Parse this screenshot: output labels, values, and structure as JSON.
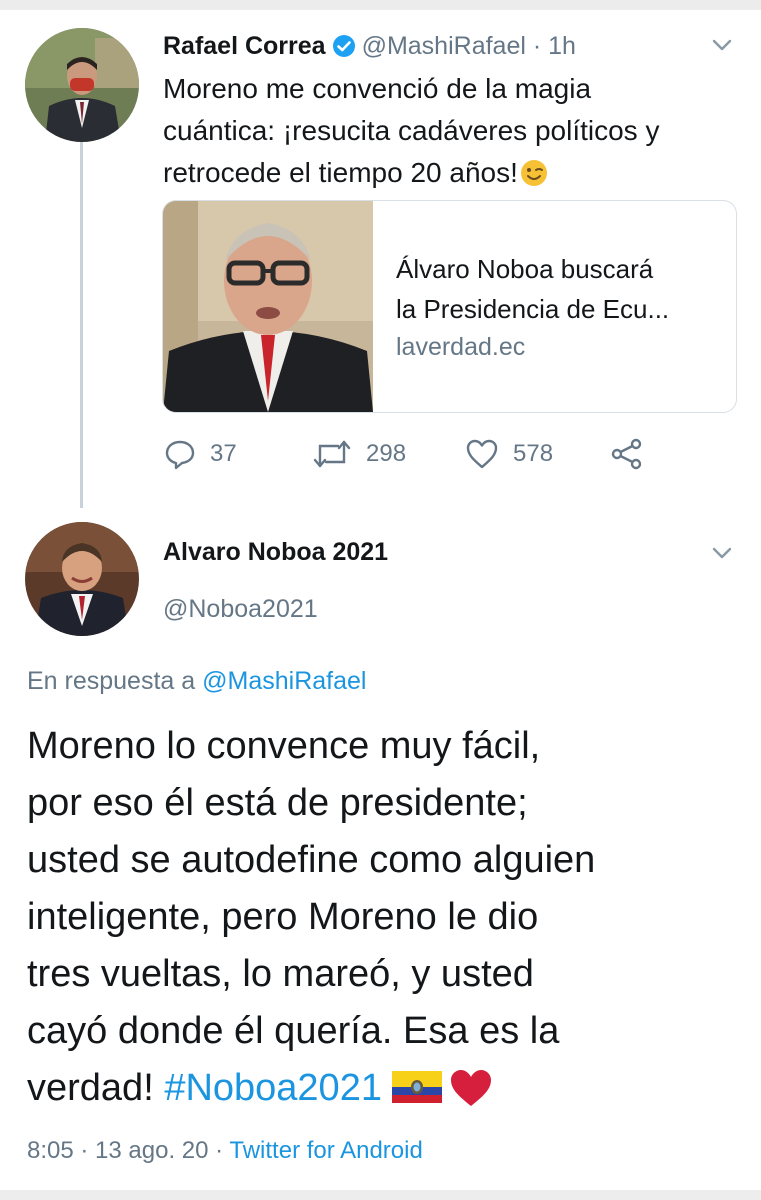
{
  "tweet1": {
    "author_name": "Rafael Correa",
    "handle": "@MashiRafael",
    "separator": " · ",
    "time": "1h",
    "text_lines": [
      "Moreno me convenció de la magia",
      "cuántica: ¡resucita cadáveres políticos y",
      "retrocede el tiempo 20 años!"
    ],
    "emoji": "winking-face",
    "link_card": {
      "title_lines": [
        "Álvaro Noboa buscará",
        "la Presidencia de Ecu..."
      ],
      "domain": "laverdad.ec"
    },
    "stats": {
      "replies": "37",
      "retweets": "298",
      "likes": "578"
    }
  },
  "tweet2": {
    "author_name": "Alvaro Noboa 2021",
    "handle": "@Noboa2021",
    "reply_prefix": "En respuesta a ",
    "reply_handle": "@MashiRafael",
    "text_lines": [
      "Moreno lo convence muy fácil,",
      "por eso él está de presidente;",
      "usted se autodefine como alguien",
      "inteligente, pero Moreno le dio",
      "tres vueltas, lo mareó, y usted",
      "cayó donde él quería. Esa es la",
      "verdad! "
    ],
    "hashtag": "#Noboa2021",
    "meta": {
      "time": "8:05",
      "date": "13 ago. 20",
      "source": "Twitter for Android",
      "separator": " · "
    }
  },
  "colors": {
    "link": "#1b95e0",
    "muted": "#657786",
    "text": "#14171a",
    "heart": "#e0245e"
  }
}
